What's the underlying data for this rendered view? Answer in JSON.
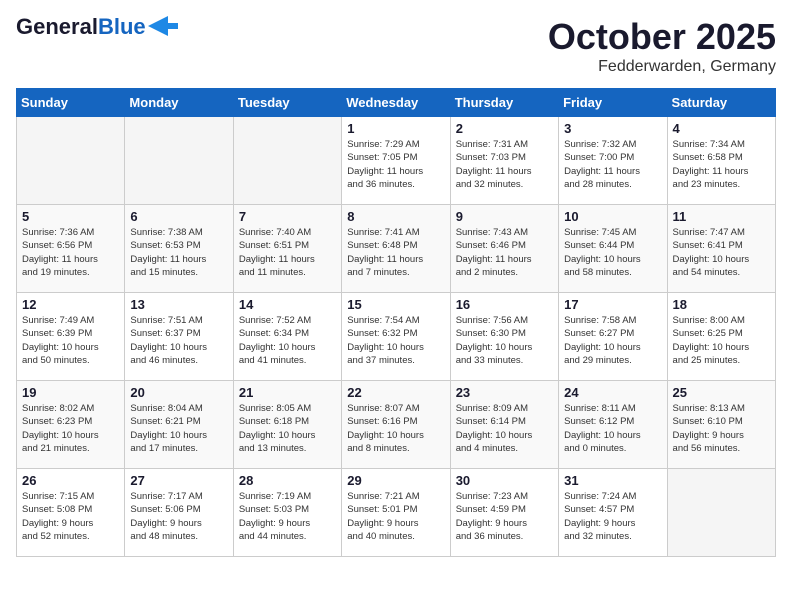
{
  "logo": {
    "general": "General",
    "blue": "Blue"
  },
  "header": {
    "month": "October 2025",
    "location": "Fedderwarden, Germany"
  },
  "weekdays": [
    "Sunday",
    "Monday",
    "Tuesday",
    "Wednesday",
    "Thursday",
    "Friday",
    "Saturday"
  ],
  "weeks": [
    [
      {
        "day": "",
        "info": ""
      },
      {
        "day": "",
        "info": ""
      },
      {
        "day": "",
        "info": ""
      },
      {
        "day": "1",
        "info": "Sunrise: 7:29 AM\nSunset: 7:05 PM\nDaylight: 11 hours\nand 36 minutes."
      },
      {
        "day": "2",
        "info": "Sunrise: 7:31 AM\nSunset: 7:03 PM\nDaylight: 11 hours\nand 32 minutes."
      },
      {
        "day": "3",
        "info": "Sunrise: 7:32 AM\nSunset: 7:00 PM\nDaylight: 11 hours\nand 28 minutes."
      },
      {
        "day": "4",
        "info": "Sunrise: 7:34 AM\nSunset: 6:58 PM\nDaylight: 11 hours\nand 23 minutes."
      }
    ],
    [
      {
        "day": "5",
        "info": "Sunrise: 7:36 AM\nSunset: 6:56 PM\nDaylight: 11 hours\nand 19 minutes."
      },
      {
        "day": "6",
        "info": "Sunrise: 7:38 AM\nSunset: 6:53 PM\nDaylight: 11 hours\nand 15 minutes."
      },
      {
        "day": "7",
        "info": "Sunrise: 7:40 AM\nSunset: 6:51 PM\nDaylight: 11 hours\nand 11 minutes."
      },
      {
        "day": "8",
        "info": "Sunrise: 7:41 AM\nSunset: 6:48 PM\nDaylight: 11 hours\nand 7 minutes."
      },
      {
        "day": "9",
        "info": "Sunrise: 7:43 AM\nSunset: 6:46 PM\nDaylight: 11 hours\nand 2 minutes."
      },
      {
        "day": "10",
        "info": "Sunrise: 7:45 AM\nSunset: 6:44 PM\nDaylight: 10 hours\nand 58 minutes."
      },
      {
        "day": "11",
        "info": "Sunrise: 7:47 AM\nSunset: 6:41 PM\nDaylight: 10 hours\nand 54 minutes."
      }
    ],
    [
      {
        "day": "12",
        "info": "Sunrise: 7:49 AM\nSunset: 6:39 PM\nDaylight: 10 hours\nand 50 minutes."
      },
      {
        "day": "13",
        "info": "Sunrise: 7:51 AM\nSunset: 6:37 PM\nDaylight: 10 hours\nand 46 minutes."
      },
      {
        "day": "14",
        "info": "Sunrise: 7:52 AM\nSunset: 6:34 PM\nDaylight: 10 hours\nand 41 minutes."
      },
      {
        "day": "15",
        "info": "Sunrise: 7:54 AM\nSunset: 6:32 PM\nDaylight: 10 hours\nand 37 minutes."
      },
      {
        "day": "16",
        "info": "Sunrise: 7:56 AM\nSunset: 6:30 PM\nDaylight: 10 hours\nand 33 minutes."
      },
      {
        "day": "17",
        "info": "Sunrise: 7:58 AM\nSunset: 6:27 PM\nDaylight: 10 hours\nand 29 minutes."
      },
      {
        "day": "18",
        "info": "Sunrise: 8:00 AM\nSunset: 6:25 PM\nDaylight: 10 hours\nand 25 minutes."
      }
    ],
    [
      {
        "day": "19",
        "info": "Sunrise: 8:02 AM\nSunset: 6:23 PM\nDaylight: 10 hours\nand 21 minutes."
      },
      {
        "day": "20",
        "info": "Sunrise: 8:04 AM\nSunset: 6:21 PM\nDaylight: 10 hours\nand 17 minutes."
      },
      {
        "day": "21",
        "info": "Sunrise: 8:05 AM\nSunset: 6:18 PM\nDaylight: 10 hours\nand 13 minutes."
      },
      {
        "day": "22",
        "info": "Sunrise: 8:07 AM\nSunset: 6:16 PM\nDaylight: 10 hours\nand 8 minutes."
      },
      {
        "day": "23",
        "info": "Sunrise: 8:09 AM\nSunset: 6:14 PM\nDaylight: 10 hours\nand 4 minutes."
      },
      {
        "day": "24",
        "info": "Sunrise: 8:11 AM\nSunset: 6:12 PM\nDaylight: 10 hours\nand 0 minutes."
      },
      {
        "day": "25",
        "info": "Sunrise: 8:13 AM\nSunset: 6:10 PM\nDaylight: 9 hours\nand 56 minutes."
      }
    ],
    [
      {
        "day": "26",
        "info": "Sunrise: 7:15 AM\nSunset: 5:08 PM\nDaylight: 9 hours\nand 52 minutes."
      },
      {
        "day": "27",
        "info": "Sunrise: 7:17 AM\nSunset: 5:06 PM\nDaylight: 9 hours\nand 48 minutes."
      },
      {
        "day": "28",
        "info": "Sunrise: 7:19 AM\nSunset: 5:03 PM\nDaylight: 9 hours\nand 44 minutes."
      },
      {
        "day": "29",
        "info": "Sunrise: 7:21 AM\nSunset: 5:01 PM\nDaylight: 9 hours\nand 40 minutes."
      },
      {
        "day": "30",
        "info": "Sunrise: 7:23 AM\nSunset: 4:59 PM\nDaylight: 9 hours\nand 36 minutes."
      },
      {
        "day": "31",
        "info": "Sunrise: 7:24 AM\nSunset: 4:57 PM\nDaylight: 9 hours\nand 32 minutes."
      },
      {
        "day": "",
        "info": ""
      }
    ]
  ]
}
